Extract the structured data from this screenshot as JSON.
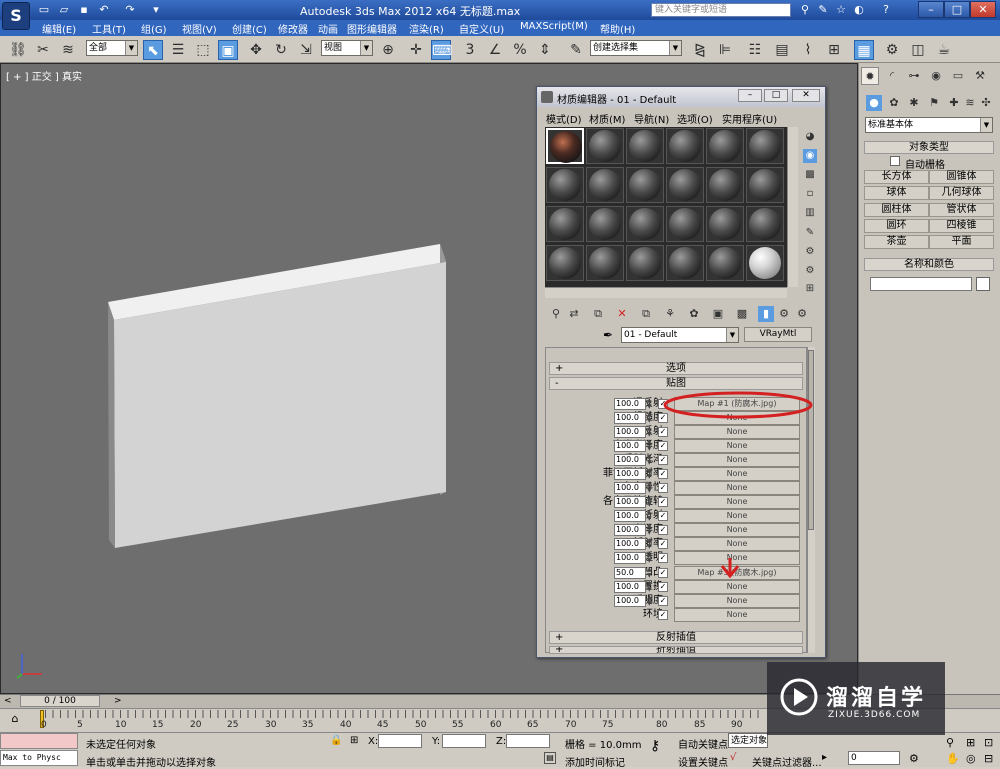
{
  "titlebar": {
    "title": "Autodesk 3ds Max  2012 x64  无标题.max",
    "search_placeholder": "键入关键字或短语",
    "app_icon": "3ds-max-logo",
    "quick_icons": [
      "new-file-icon",
      "open-folder-icon",
      "save-icon",
      "undo-icon",
      "redo-icon",
      "dropdown-icon"
    ]
  },
  "menubar": {
    "items": [
      "编辑(E)",
      "工具(T)",
      "组(G)",
      "视图(V)",
      "创建(C)",
      "修改器",
      "动画",
      "图形编辑器",
      "渲染(R)",
      "自定义(U)",
      "MAXScript(M)",
      "帮助(H)"
    ]
  },
  "toolbar": {
    "selection_filter": "全部",
    "ref_coord": "视图",
    "named_selection": "创建选择集",
    "snap_label": "3"
  },
  "viewport": {
    "label": "[ + ] 正交 ] 真实"
  },
  "command_panel": {
    "dropdown": "标准基本体",
    "object_type_title": "对象类型",
    "autogrid_label": "自动栅格",
    "objects": [
      "长方体",
      "圆锥体",
      "球体",
      "几何球体",
      "圆柱体",
      "管状体",
      "圆环",
      "四棱锥",
      "茶壶",
      "平面"
    ],
    "name_color_title": "名称和颜色"
  },
  "material_editor": {
    "title": "材质编辑器 - 01 - Default",
    "menus": [
      "模式(D)",
      "材质(M)",
      "导航(N)",
      "选项(O)",
      "实用程序(U)"
    ],
    "material_name": "01 - Default",
    "material_type": "VRayMtl",
    "rollouts": {
      "options": "选项",
      "maps": "贴图",
      "reflect_interp": "反射插值",
      "refract_interp": "折射插值"
    },
    "map_rows": [
      {
        "label": "漫反射",
        "value": "100.0",
        "checked": "✓",
        "map": "Map #1 (防腐木.jpg)"
      },
      {
        "label": "粗糙度",
        "value": "100.0",
        "checked": "✓",
        "map": "None"
      },
      {
        "label": "反射",
        "value": "100.0",
        "checked": "✓",
        "map": "None"
      },
      {
        "label": "高光光泽度",
        "value": "100.0",
        "checked": "✓",
        "map": "None"
      },
      {
        "label": "反射光泽",
        "value": "100.0",
        "checked": "✓",
        "map": "None"
      },
      {
        "label": "菲涅耳折射率",
        "value": "100.0",
        "checked": "✓",
        "map": "None"
      },
      {
        "label": "各向异性",
        "value": "100.0",
        "checked": "✓",
        "map": "None"
      },
      {
        "label": "各向异性旋转",
        "value": "100.0",
        "checked": "✓",
        "map": "None"
      },
      {
        "label": "折射",
        "value": "100.0",
        "checked": "✓",
        "map": "None"
      },
      {
        "label": "光泽度",
        "value": "100.0",
        "checked": "✓",
        "map": "None"
      },
      {
        "label": "折射率",
        "value": "100.0",
        "checked": "✓",
        "map": "None"
      },
      {
        "label": "透明",
        "value": "100.0",
        "checked": "✓",
        "map": "None"
      },
      {
        "label": "凹凸",
        "value": "50.0",
        "checked": "✓",
        "map": "Map #3 (防腐木.jpg)"
      },
      {
        "label": "置换",
        "value": "100.0",
        "checked": "✓",
        "map": "None"
      },
      {
        "label": "不透明度",
        "value": "100.0",
        "checked": "✓",
        "map": "None"
      },
      {
        "label": "环境",
        "value": "",
        "checked": "✓",
        "map": "None"
      }
    ],
    "annotation_color": "#d42020"
  },
  "timeline": {
    "frame": "0 / 100",
    "ticks": [
      "0",
      "5",
      "10",
      "15",
      "20",
      "25",
      "30",
      "35",
      "40",
      "45",
      "50",
      "55",
      "60",
      "65",
      "70",
      "75",
      "80",
      "85",
      "90"
    ]
  },
  "statusbar": {
    "script_listener": "Max to Physc",
    "status_line": "未选定任何对象",
    "prompt_line": "单击或单击并拖动以选择对象",
    "x_label": "X:",
    "y_label": "Y:",
    "z_label": "Z:",
    "grid": "栅格 = 10.0mm",
    "add_time_tag": "添加时间标记",
    "auto_key": "自动关键点",
    "selected_obj": "选定对象",
    "set_key": "设置关键点",
    "key_filter": "关键点过滤器...",
    "frame_field": "0"
  },
  "watermark": {
    "brand": "溜溜自学",
    "url": "ZIXUE.3D66.COM"
  }
}
